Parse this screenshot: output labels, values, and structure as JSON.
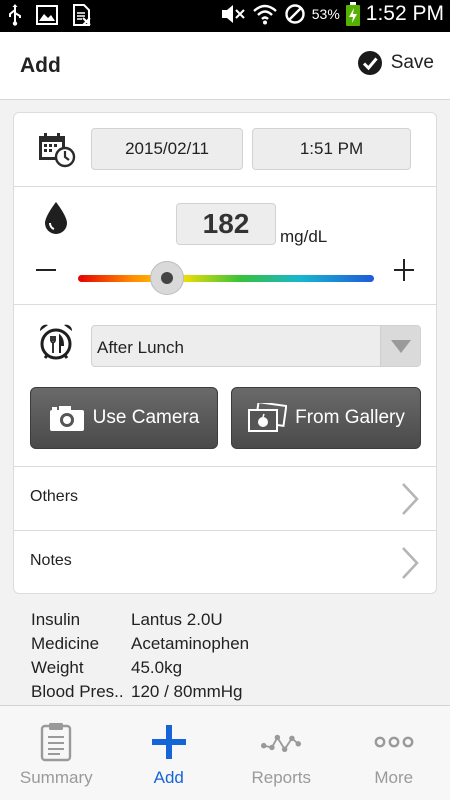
{
  "status_bar": {
    "battery": "53%",
    "time": "1:52 PM"
  },
  "header": {
    "title": "Add",
    "save_label": "Save"
  },
  "entry": {
    "date": "2015/02/11",
    "time": "1:51 PM",
    "glucose_value": "182",
    "glucose_unit": "mg/dL",
    "slider_level": 0.3,
    "meal_selected": "After Lunch",
    "camera_label": "Use Camera",
    "gallery_label": "From Gallery",
    "others_label": "Others",
    "notes_label": "Notes"
  },
  "details": [
    {
      "key": "Insulin",
      "value": "Lantus 2.0U"
    },
    {
      "key": "Medicine",
      "value": "Acetaminophen"
    },
    {
      "key": "Weight",
      "value": "45.0kg"
    },
    {
      "key": "Blood Pres..",
      "value": "120 / 80mmHg"
    }
  ],
  "nav": [
    {
      "label": "Summary",
      "icon": "clipboard-icon",
      "active": false
    },
    {
      "label": "Add",
      "icon": "plus-icon",
      "active": true
    },
    {
      "label": "Reports",
      "icon": "chart-icon",
      "active": false
    },
    {
      "label": "More",
      "icon": "more-dots-icon",
      "active": false
    }
  ],
  "colors": {
    "accent": "#1565d8",
    "button_dark": "#555555",
    "inactive_nav": "#9a9a9a"
  }
}
